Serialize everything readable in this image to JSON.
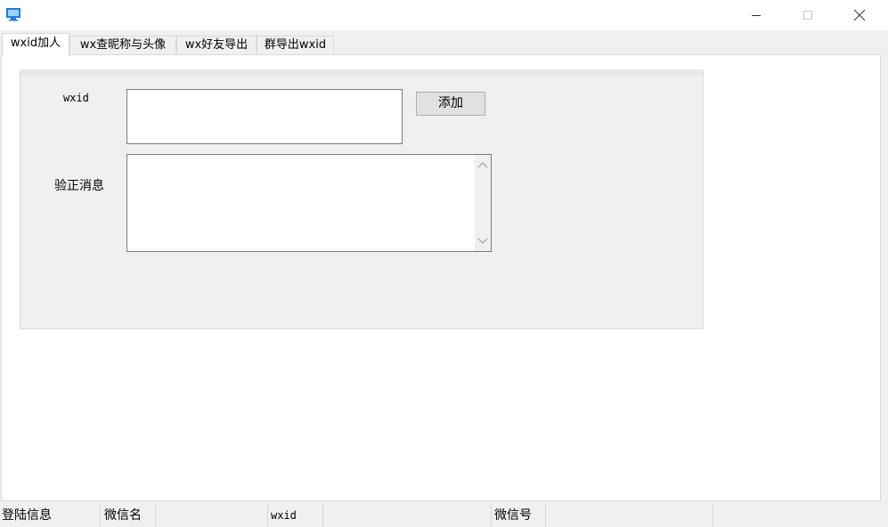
{
  "window": {
    "title": "",
    "colors": {
      "titlebar": "#ffffff",
      "icon": "#1e7fd4"
    }
  },
  "tabs": [
    {
      "label": "wxid加人",
      "active": true
    },
    {
      "label": "wx查昵称与头像",
      "active": false
    },
    {
      "label": "wx好友导出",
      "active": false
    },
    {
      "label": "群导出wxid",
      "active": false
    }
  ],
  "form": {
    "wxid_label": "wxid",
    "wxid_value": "",
    "message_label": "验正消息",
    "message_value": "",
    "add_button": "添加"
  },
  "statusbar": {
    "cells": [
      "登陆信息",
      "微信名",
      "",
      "wxid",
      "",
      "微信号",
      "",
      ""
    ]
  },
  "icons": {
    "app": "app-monitor-icon",
    "minimize": "minimize-icon",
    "maximize": "maximize-icon",
    "close": "close-icon",
    "scroll_up": "chevron-up-icon",
    "scroll_down": "chevron-down-icon"
  }
}
